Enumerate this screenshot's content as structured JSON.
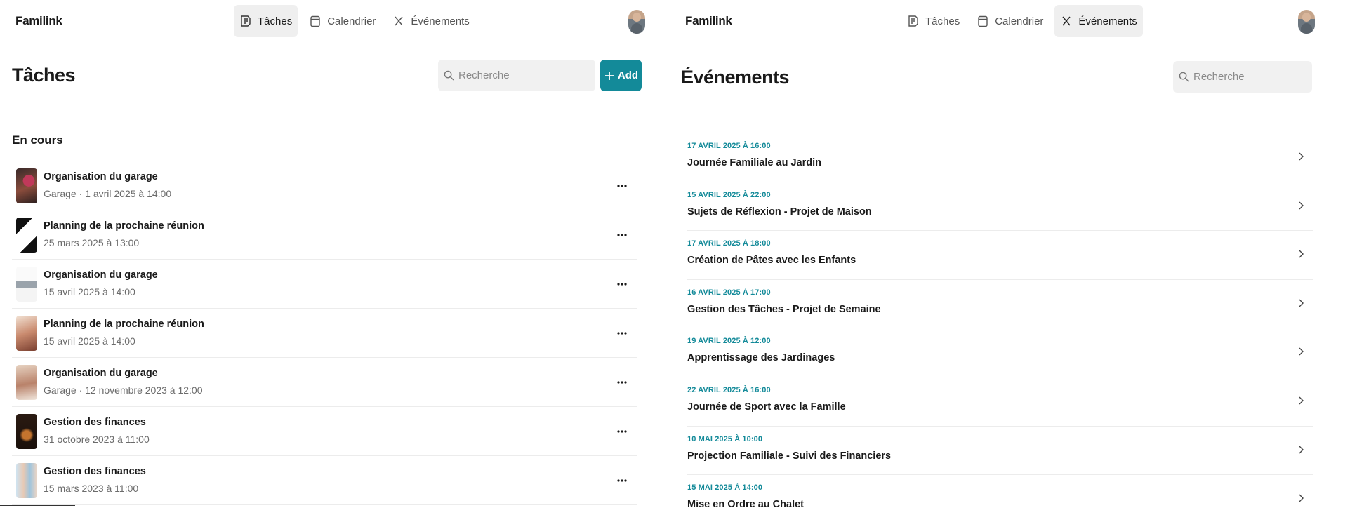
{
  "left": {
    "brand": "Familink",
    "nav": [
      {
        "label": "Tâches",
        "icon": "task-list-icon",
        "active": true
      },
      {
        "label": "Calendrier",
        "icon": "calendar-icon",
        "active": false
      },
      {
        "label": "Événements",
        "icon": "x-icon",
        "active": false
      }
    ],
    "title": "Tâches",
    "search_placeholder": "Recherche",
    "add_label": "Add",
    "section_title": "En cours",
    "tasks": [
      {
        "title": "Organisation du garage",
        "subtitle": "Garage · 1 avril 2025 à 14:00",
        "thumb": "photo-people-garage"
      },
      {
        "title": "Planning de la prochaine réunion",
        "subtitle": " 25 mars 2025 à 13:00",
        "thumb": "photo-abstract-dark"
      },
      {
        "title": "Organisation du garage",
        "subtitle": " 15 avril 2025 à 14:00",
        "thumb": "photo-laptop"
      },
      {
        "title": "Planning de la prochaine réunion",
        "subtitle": " 15 avril 2025 à 14:00",
        "thumb": "photo-living-room"
      },
      {
        "title": "Organisation du garage",
        "subtitle": "Garage · 12 novembre 2023 à 12:00",
        "thumb": "photo-group-meeting"
      },
      {
        "title": "Gestion des finances",
        "subtitle": " 31 octobre 2023 à 11:00",
        "thumb": "photo-dark-interior"
      },
      {
        "title": "Gestion des finances",
        "subtitle": " 15 mars 2023 à 11:00",
        "thumb": "photo-people-outdoor"
      }
    ]
  },
  "right": {
    "brand": "Familink",
    "nav": [
      {
        "label": "Tâches",
        "icon": "task-list-icon",
        "active": false
      },
      {
        "label": "Calendrier",
        "icon": "calendar-icon",
        "active": false
      },
      {
        "label": "Événements",
        "icon": "x-icon",
        "active": true
      }
    ],
    "title": "Événements",
    "search_placeholder": "Recherche",
    "events": [
      {
        "date": "17 AVRIL 2025 À 16:00",
        "name": "Journée Familiale au Jardin"
      },
      {
        "date": "15 AVRIL 2025 À 22:00",
        "name": "Sujets de Réflexion - Projet de Maison"
      },
      {
        "date": "17 AVRIL 2025 À 18:00",
        "name": "Création de Pâtes avec les Enfants"
      },
      {
        "date": "16 AVRIL 2025 À 17:00",
        "name": "Gestion des Tâches - Projet de Semaine"
      },
      {
        "date": "19 AVRIL 2025 À 12:00",
        "name": "Apprentissage des Jardinages"
      },
      {
        "date": "22 AVRIL 2025 À 16:00",
        "name": "Journée de Sport avec la Famille"
      },
      {
        "date": "10 MAI 2025 À 10:00",
        "name": "Projection Familiale - Suivi des Financiers"
      },
      {
        "date": "15 MAI 2025 À 14:00",
        "name": "Mise en Ordre au Chalet"
      }
    ]
  },
  "colors": {
    "accent": "#138a99",
    "nav_active_bg": "#efefef",
    "divider": "#ececec",
    "search_bg": "#f1f1f1"
  }
}
